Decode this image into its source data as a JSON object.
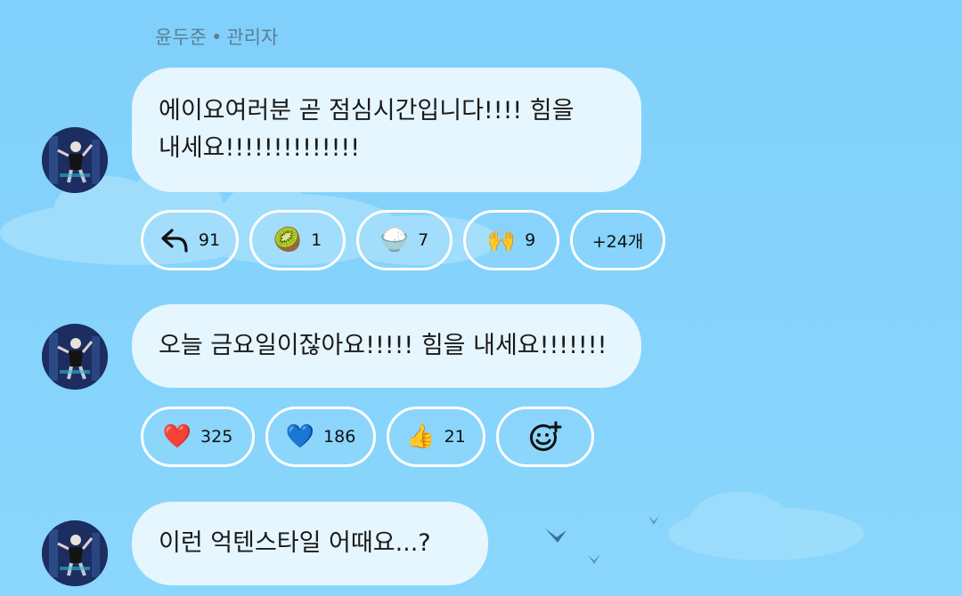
{
  "sender": {
    "name": "윤두준",
    "separator": "•",
    "role": "관리자"
  },
  "messages": [
    {
      "lines": [
        "에이요여러분 곧 점심시간입니다!!!! 힘을",
        "내세요!!!!!!!!!!!!!!"
      ],
      "reactions": [
        {
          "icon": "reply-icon",
          "emoji": "",
          "count": "91"
        },
        {
          "icon": "kiwi-emoji",
          "emoji": "🥝",
          "count": "1"
        },
        {
          "icon": "rice-bowl-emoji",
          "emoji": "🍚",
          "count": "7"
        },
        {
          "icon": "raising-hands-emoji",
          "emoji": "🙌",
          "count": "9"
        }
      ],
      "more": "+24개"
    },
    {
      "text": "오늘 금요일이잖아요!!!!! 힘을 내세요!!!!!!!",
      "reactions": [
        {
          "icon": "red-heart-emoji",
          "emoji": "❤️",
          "count": "325"
        },
        {
          "icon": "blue-heart-emoji",
          "emoji": "💙",
          "count": "186"
        },
        {
          "icon": "thumbs-up-emoji",
          "emoji": "👍",
          "count": "21"
        }
      ],
      "add_reaction_icon": "add-reaction-icon"
    },
    {
      "text": "이런 억텐스타일 어때요...?"
    }
  ],
  "colors": {
    "background": "#84d2fb",
    "bubble": "#e6f6fe",
    "chip_border": "#ffffff",
    "sender_text": "#5b7f96"
  }
}
